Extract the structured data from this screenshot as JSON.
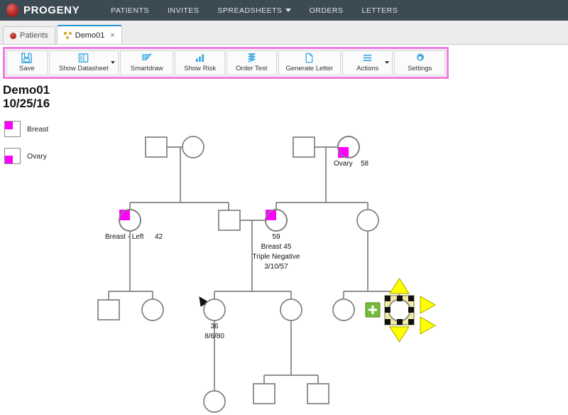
{
  "header": {
    "brand": "PROGENY",
    "logo_icon": "progeny-orb-icon",
    "nav": [
      {
        "label": "PATIENTS",
        "has_caret": false
      },
      {
        "label": "INVITES",
        "has_caret": false
      },
      {
        "label": "SPREADSHEETS",
        "has_caret": true
      },
      {
        "label": "ORDERS",
        "has_caret": false
      },
      {
        "label": "LETTERS",
        "has_caret": false
      }
    ]
  },
  "tabs": [
    {
      "label": "Patients",
      "icon": "red-orb-icon",
      "active": false,
      "closable": false
    },
    {
      "label": "Demo01",
      "icon": "pedigree-icon",
      "active": true,
      "closable": true,
      "close_label": "×"
    }
  ],
  "toolbar": {
    "highlight_color": "#ef7fe0",
    "buttons": [
      {
        "label": "Save",
        "icon": "save-disk-icon",
        "split": false
      },
      {
        "label": "Show Datasheet",
        "icon": "datasheet-icon",
        "split": true
      },
      {
        "label": "Smartdraw",
        "icon": "smartdraw-pencil-icon",
        "split": false
      },
      {
        "label": "Show Risk",
        "icon": "bar-chart-icon",
        "split": false
      },
      {
        "label": "Order Test",
        "icon": "order-test-icon",
        "split": false
      },
      {
        "label": "Generate Letter",
        "icon": "document-icon",
        "split": false
      },
      {
        "label": "Actions",
        "icon": "hamburger-icon",
        "split": true
      },
      {
        "label": "Settings",
        "icon": "gear-icon",
        "split": false
      }
    ]
  },
  "chart": {
    "title": "Demo01",
    "date": "10/25/16",
    "legend": [
      {
        "label": "Breast",
        "color": "#ff00ff",
        "quadrant": "top-left"
      },
      {
        "label": "Ovary",
        "color": "#ff00ff",
        "quadrant": "bottom-left"
      }
    ]
  },
  "chart_data": {
    "type": "pedigree",
    "title": "Demo01",
    "date": "10/25/16",
    "affected_color": "#ff00ff",
    "line_color": "#808080",
    "legend": [
      {
        "label": "Breast",
        "quadrant": "top-left"
      },
      {
        "label": "Ovary",
        "quadrant": "bottom-left"
      }
    ],
    "generations": 4,
    "individuals": [
      {
        "id": "g1m1",
        "sex": "male",
        "generation": 1,
        "affected": [],
        "labels": []
      },
      {
        "id": "g1f1",
        "sex": "female",
        "generation": 1,
        "affected": [],
        "labels": []
      },
      {
        "id": "g1m2",
        "sex": "male",
        "generation": 1,
        "affected": [],
        "labels": []
      },
      {
        "id": "g1f2",
        "sex": "female",
        "generation": 1,
        "affected": [
          "bottom-left"
        ],
        "labels": [
          "Ovary",
          "58"
        ]
      },
      {
        "id": "g2f1",
        "sex": "female",
        "generation": 2,
        "affected": [
          "top-left"
        ],
        "labels": [
          "Breast - Left",
          "42"
        ]
      },
      {
        "id": "g2m1",
        "sex": "male",
        "generation": 2,
        "affected": [],
        "labels": []
      },
      {
        "id": "g2f2",
        "sex": "female",
        "generation": 2,
        "affected": [
          "top-left"
        ],
        "labels": [
          "59",
          "Breast   45",
          "Triple Negative",
          "3/10/57"
        ]
      },
      {
        "id": "g2f3",
        "sex": "female",
        "generation": 2,
        "affected": [],
        "labels": []
      },
      {
        "id": "g3m1",
        "sex": "male",
        "generation": 3,
        "affected": [],
        "labels": []
      },
      {
        "id": "g3f1",
        "sex": "female",
        "generation": 3,
        "affected": [],
        "labels": []
      },
      {
        "id": "g3f2",
        "sex": "female",
        "generation": 3,
        "affected": [],
        "labels": [
          "36",
          "8/6/80"
        ],
        "proband": true
      },
      {
        "id": "g3f3",
        "sex": "female",
        "generation": 3,
        "affected": [],
        "labels": []
      },
      {
        "id": "g3f4",
        "sex": "female",
        "generation": 3,
        "affected": [],
        "labels": []
      },
      {
        "id": "g3f5",
        "sex": "female",
        "generation": 3,
        "affected": [],
        "labels": [],
        "selected": true
      },
      {
        "id": "g4f1",
        "sex": "female",
        "generation": 4,
        "affected": [],
        "labels": []
      },
      {
        "id": "g4m1",
        "sex": "male",
        "generation": 4,
        "affected": [],
        "labels": []
      },
      {
        "id": "g4m2",
        "sex": "male",
        "generation": 4,
        "affected": [],
        "labels": []
      }
    ],
    "selection": {
      "target": "g3f5",
      "handle_color": "#ffff00",
      "frame_color": "#f2eaa0",
      "arrows": [
        "up",
        "down",
        "right-upper",
        "right-lower"
      ],
      "add_button": {
        "label": "+",
        "color": "#74bb3c",
        "name": "add-relative-button"
      }
    },
    "proband": {
      "target": "g3f2",
      "marker": "arrow"
    }
  }
}
